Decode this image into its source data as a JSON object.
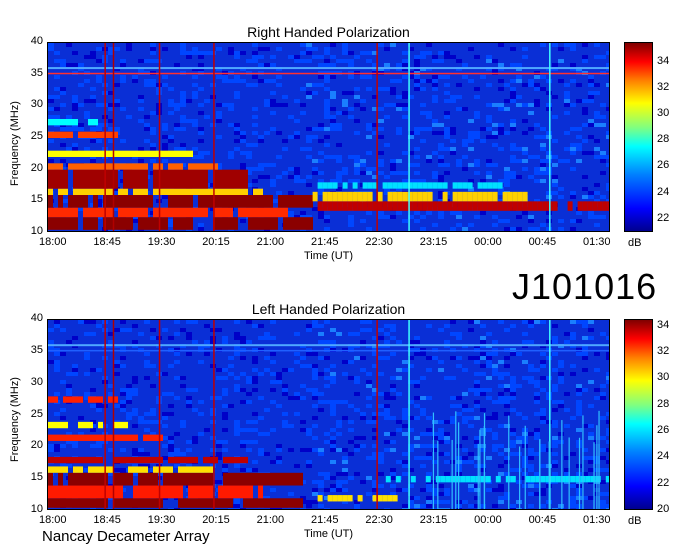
{
  "source_id": "J101016",
  "credit": "Nancay Decameter Array",
  "chart_data": [
    {
      "type": "heatmap",
      "title": "Right Handed Polarization",
      "xlabel": "Time (UT)",
      "ylabel": "Frequency (MHz)",
      "x_ticks": [
        "18:00",
        "18:45",
        "19:30",
        "20:15",
        "21:00",
        "21:45",
        "22:30",
        "23:15",
        "00:00",
        "00:45",
        "01:30"
      ],
      "y_ticks": [
        "10",
        "15",
        "20",
        "25",
        "30",
        "35",
        "40"
      ],
      "xlim": [
        "18:00",
        "01:45"
      ],
      "ylim": [
        10,
        40
      ],
      "colorbar": {
        "unit": "dB",
        "ticks": [
          "22",
          "24",
          "26",
          "28",
          "30",
          "32",
          "34"
        ],
        "range": [
          21,
          35.5
        ]
      },
      "colors": [
        "#00008f",
        "#0000ff",
        "#0080ff",
        "#00ffff",
        "#ffff00",
        "#ff0000",
        "#800000"
      ]
    },
    {
      "type": "heatmap",
      "title": "Left Handed Polarization",
      "xlabel": "Time (UT)",
      "ylabel": "Frequency (MHz)",
      "x_ticks": [
        "18:00",
        "18:45",
        "19:30",
        "20:15",
        "21:00",
        "21:45",
        "22:30",
        "23:15",
        "00:00",
        "00:45",
        "01:30"
      ],
      "y_ticks": [
        "10",
        "15",
        "20",
        "25",
        "30",
        "35",
        "40"
      ],
      "xlim": [
        "18:00",
        "01:45"
      ],
      "ylim": [
        10,
        40
      ],
      "colorbar": {
        "unit": "dB",
        "ticks": [
          "20",
          "22",
          "24",
          "26",
          "28",
          "30",
          "32",
          "34"
        ],
        "range": [
          20,
          34.5
        ]
      },
      "colors": [
        "#00008f",
        "#0000ff",
        "#0080ff",
        "#00ffff",
        "#ffff00",
        "#ff0000",
        "#800000"
      ]
    }
  ]
}
